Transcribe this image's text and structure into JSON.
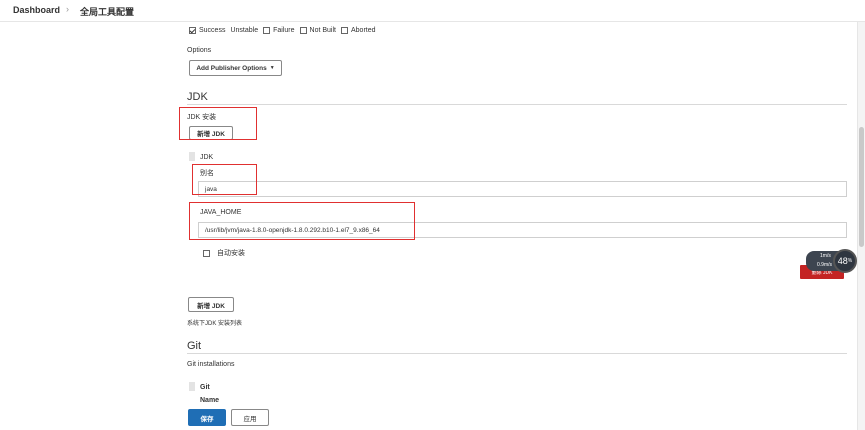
{
  "breadcrumb": {
    "dashboard": "Dashboard",
    "separator": "›",
    "current": "全局工具配置"
  },
  "build_status": {
    "options": [
      {
        "label": "Success",
        "checked": true
      },
      {
        "label": "Unstable",
        "checked": false
      },
      {
        "label": "Failure",
        "checked": false
      },
      {
        "label": "Not Built",
        "checked": false
      },
      {
        "label": "Aborted",
        "checked": false
      }
    ]
  },
  "options": {
    "label": "Options",
    "add_publisher_button": "Add Publisher Options",
    "dropdown_icon": "caret-down-icon"
  },
  "jdk": {
    "section_title": "JDK",
    "install_label": "JDK 安装",
    "add_button": "新增 JDK",
    "item_header": "JDK",
    "alias_label": "别名",
    "alias_value": "java",
    "java_home_label": "JAVA_HOME",
    "java_home_value": "/usr/lib/jvm/java-1.8.0-openjdk-1.8.0.292.b10-1.el7_9.x86_64",
    "auto_install_label": "自动安装",
    "auto_install_checked": false,
    "delete_button": "删除 JDK",
    "add_button_2": "新增 JDK",
    "system_list_note": "系统下JDK 安装列表"
  },
  "git": {
    "section_title": "Git",
    "installations_label": "Git installations",
    "item_header": "Git",
    "name_label": "Name"
  },
  "footer": {
    "save_button": "保存",
    "apply_button": "应用"
  },
  "widget": {
    "line1": "1m/s",
    "line2": "0.9m/s",
    "percent": "48",
    "percent_unit": "%"
  },
  "colors": {
    "primary": "#1f6eb5",
    "annotation_red": "#e03030",
    "delete_red": "#c42424"
  }
}
